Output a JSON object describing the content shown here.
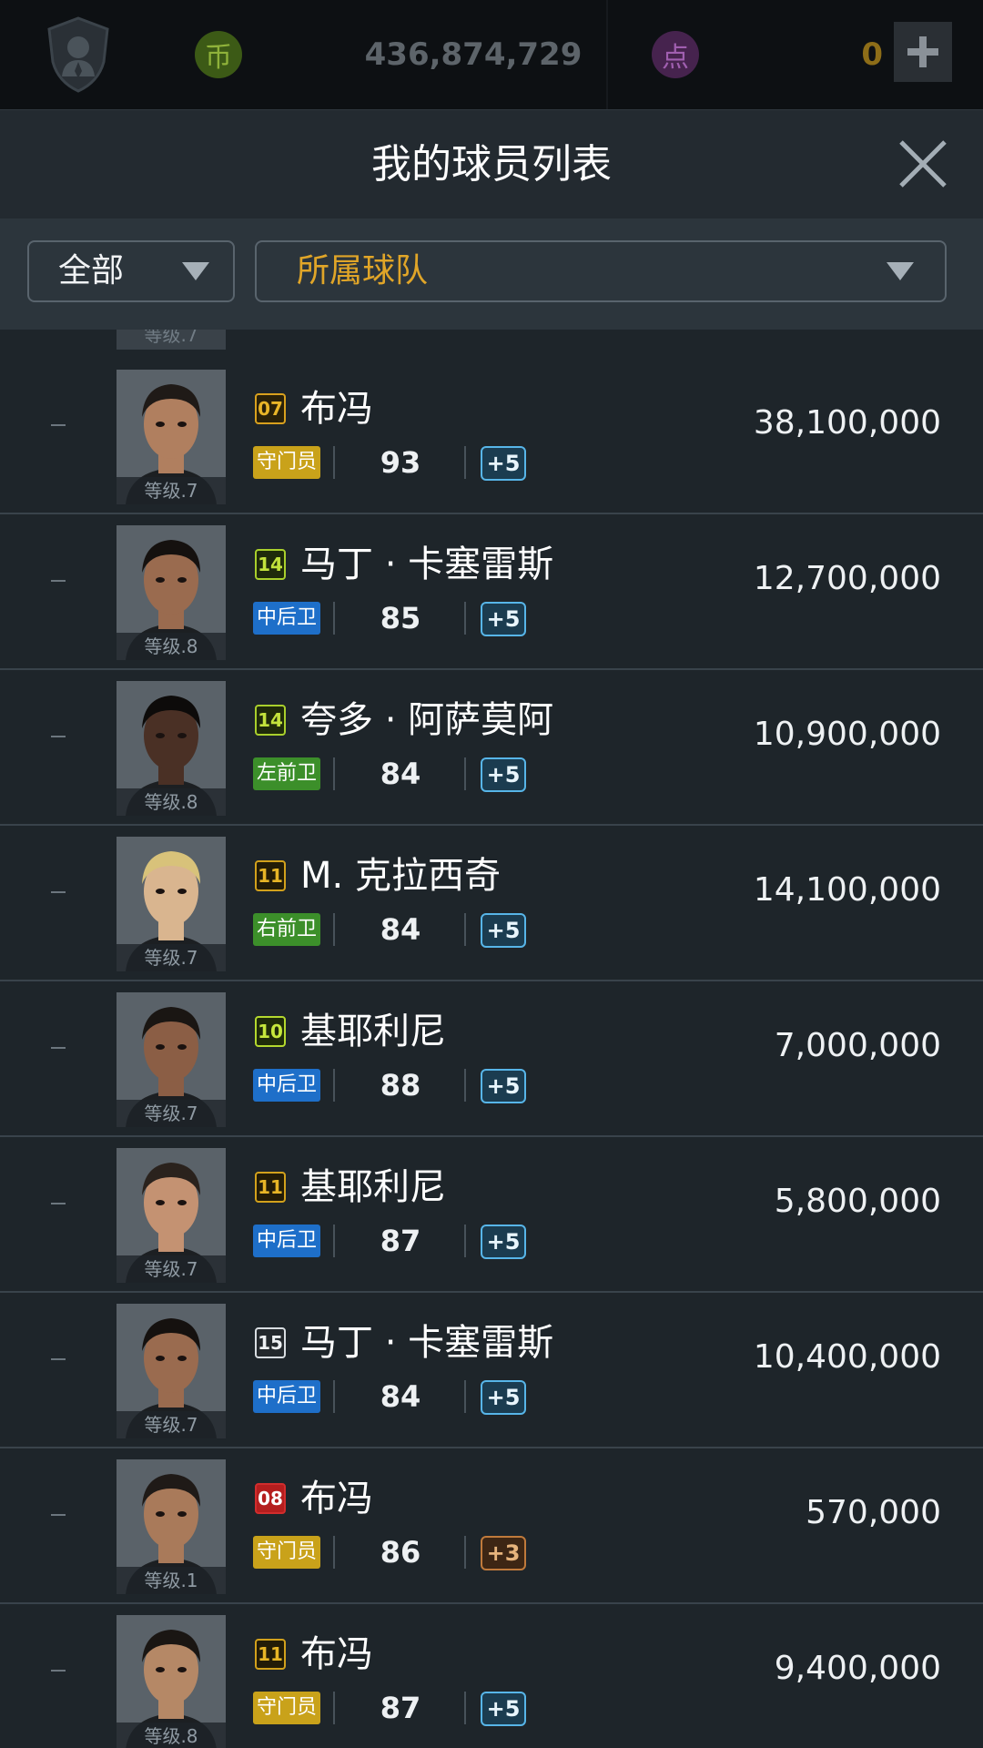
{
  "topbar": {
    "coin_icon": "币",
    "coins": "436,874,729",
    "point_icon": "点",
    "points": "0"
  },
  "header": {
    "title": "我的球员列表"
  },
  "filters": {
    "category": "全部",
    "team": "所属球队"
  },
  "partial_level": "等级.7",
  "colors": {
    "gk": "#c9a21a",
    "cb": "#1e6fc9",
    "wing": "#3c8f2a",
    "boost_blue": "#57b5e8",
    "boost_bronze": "#c07a3b",
    "team_filter": "#e0a528"
  },
  "players": [
    {
      "season": "07",
      "name": "布冯",
      "pos": "守门员",
      "pos_type": "gk",
      "ovr": "93",
      "boost": "+5",
      "boost_type": "blue",
      "level": "等级.7",
      "price": "38,100,000"
    },
    {
      "season": "14",
      "name": "马丁 · 卡塞雷斯",
      "pos": "中后卫",
      "pos_type": "cb",
      "ovr": "85",
      "boost": "+5",
      "boost_type": "blue",
      "level": "等级.8",
      "price": "12,700,000"
    },
    {
      "season": "14",
      "name": "夸多 · 阿萨莫阿",
      "pos": "左前卫",
      "pos_type": "wing",
      "ovr": "84",
      "boost": "+5",
      "boost_type": "blue",
      "level": "等级.8",
      "price": "10,900,000"
    },
    {
      "season": "11",
      "name": "M. 克拉西奇",
      "pos": "右前卫",
      "pos_type": "wing",
      "ovr": "84",
      "boost": "+5",
      "boost_type": "blue",
      "level": "等级.7",
      "price": "14,100,000"
    },
    {
      "season": "10",
      "name": "基耶利尼",
      "pos": "中后卫",
      "pos_type": "cb",
      "ovr": "88",
      "boost": "+5",
      "boost_type": "blue",
      "level": "等级.7",
      "price": "7,000,000"
    },
    {
      "season": "11",
      "name": "基耶利尼",
      "pos": "中后卫",
      "pos_type": "cb",
      "ovr": "87",
      "boost": "+5",
      "boost_type": "blue",
      "level": "等级.7",
      "price": "5,800,000"
    },
    {
      "season": "15",
      "name": "马丁 · 卡塞雷斯",
      "pos": "中后卫",
      "pos_type": "cb",
      "ovr": "84",
      "boost": "+5",
      "boost_type": "blue",
      "level": "等级.7",
      "price": "10,400,000"
    },
    {
      "season": "08",
      "name": "布冯",
      "pos": "守门员",
      "pos_type": "gk",
      "ovr": "86",
      "boost": "+3",
      "boost_type": "bronze",
      "level": "等级.1",
      "price": "570,000"
    },
    {
      "season": "11",
      "name": "布冯",
      "pos": "守门员",
      "pos_type": "gk",
      "ovr": "87",
      "boost": "+5",
      "boost_type": "blue",
      "level": "等级.8",
      "price": "9,400,000"
    }
  ]
}
